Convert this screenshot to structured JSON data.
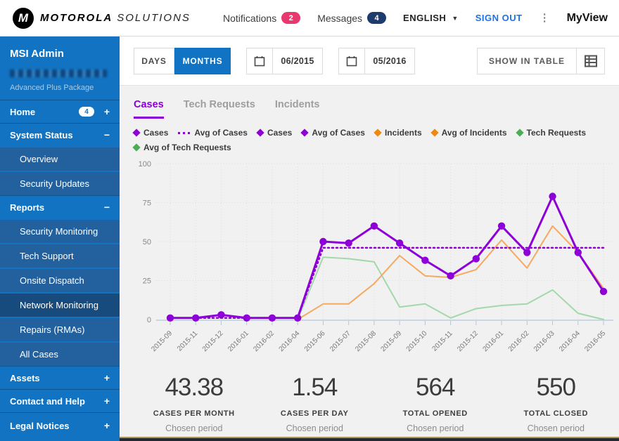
{
  "header": {
    "brand_primary": "MOTOROLA",
    "brand_secondary": "SOLUTIONS",
    "notifications_label": "Notifications",
    "notifications_count": "2",
    "messages_label": "Messages",
    "messages_count": "4",
    "language": "ENGLISH",
    "sign_out_label": "SIGN OUT",
    "product_name": "MyView",
    "colors": {
      "notifications_badge": "#e8386d",
      "messages_badge": "#1d3c6b",
      "sign_out": "#1a73e8"
    }
  },
  "sidebar": {
    "user_name": "MSI Admin",
    "package_label": "Advanced Plus Package",
    "items": [
      {
        "label": "Home",
        "type": "top",
        "badge": "4",
        "toggle": "+"
      },
      {
        "label": "System Status",
        "type": "top",
        "toggle": "−"
      },
      {
        "label": "Overview",
        "type": "sub"
      },
      {
        "label": "Security Updates",
        "type": "sub"
      },
      {
        "label": "Reports",
        "type": "top",
        "toggle": "−"
      },
      {
        "label": "Security Monitoring",
        "type": "sub"
      },
      {
        "label": "Tech Support",
        "type": "sub"
      },
      {
        "label": "Onsite Dispatch",
        "type": "sub"
      },
      {
        "label": "Network Monitoring",
        "type": "sub",
        "selected": true
      },
      {
        "label": "Repairs (RMAs)",
        "type": "sub"
      },
      {
        "label": "All Cases",
        "type": "sub"
      },
      {
        "label": "Assets",
        "type": "top",
        "toggle": "+"
      },
      {
        "label": "Contact and Help",
        "type": "top",
        "toggle": "+"
      },
      {
        "label": "Legal Notices",
        "type": "top",
        "toggle": "+",
        "tall": true
      }
    ],
    "colors": {
      "base": "#1173c2",
      "submenu": "#22609e",
      "selected": "#174a7d"
    }
  },
  "toolbar": {
    "days_label": "DAYS",
    "months_label": "MONTHS",
    "date_from": "06/2015",
    "date_to": "05/2016",
    "show_in_table_label": "SHOW IN TABLE"
  },
  "tabs": [
    {
      "label": "Cases",
      "active": true
    },
    {
      "label": "Tech Requests",
      "active": false
    },
    {
      "label": "Incidents",
      "active": false
    }
  ],
  "legend": [
    {
      "label": "Cases",
      "marker": "diamond",
      "color": "#8f00d4"
    },
    {
      "label": "Avg of Cases",
      "marker": "dotted",
      "color": "#8f00d4"
    },
    {
      "label": "Cases",
      "marker": "diamond",
      "color": "#8f00d4"
    },
    {
      "label": "Avg of Cases",
      "marker": "diamond",
      "color": "#8f00d4"
    },
    {
      "label": "Incidents",
      "marker": "diamond",
      "color": "#f0870e"
    },
    {
      "label": "Avg of Incidents",
      "marker": "diamond",
      "color": "#f0870e"
    },
    {
      "label": "Tech Requests",
      "marker": "diamond",
      "color": "#4cae52"
    },
    {
      "label": "Avg of Tech Requests",
      "marker": "diamond",
      "color": "#4cae52"
    }
  ],
  "chart_data": {
    "type": "line",
    "title": "",
    "xlabel": "",
    "ylabel": "",
    "ylim": [
      0,
      100
    ],
    "yticks": [
      0,
      25,
      50,
      75,
      100
    ],
    "grid": true,
    "legend_position": "top",
    "categories": [
      "2015-09",
      "2015-11",
      "2015-12",
      "2016-01",
      "2016-02",
      "2016-04",
      "2015-06",
      "2015-07",
      "2015-08",
      "2015-09",
      "2015-10",
      "2015-11",
      "2015-12",
      "2016-01",
      "2016-02",
      "2016-03",
      "2016-04",
      "2016-05"
    ],
    "series": [
      {
        "name": "Tech Requests",
        "color": "#a2d8aa",
        "width": 2,
        "marker": false,
        "values": [
          null,
          null,
          null,
          null,
          null,
          0,
          40,
          39,
          37,
          8,
          10,
          1,
          7,
          9,
          10,
          19,
          4,
          0
        ]
      },
      {
        "name": "Incidents",
        "color": "#f5a961",
        "width": 2,
        "marker": false,
        "values": [
          null,
          null,
          null,
          null,
          null,
          0,
          10,
          10,
          23,
          41,
          28,
          27,
          32,
          51,
          33,
          60,
          43,
          20
        ]
      },
      {
        "name": "Avg of Cases",
        "color": "#8f00d4",
        "width": 2.5,
        "dash": "2,4",
        "marker": false,
        "values": [
          1,
          1,
          1,
          1,
          1,
          1,
          46,
          46,
          46,
          46,
          46,
          46,
          46,
          46,
          46,
          46,
          46,
          46
        ]
      },
      {
        "name": "Cases",
        "color": "#8e00d8",
        "width": 3,
        "marker": true,
        "values": [
          1,
          1,
          3,
          1,
          1,
          1,
          50,
          49,
          60,
          49,
          38,
          28,
          39,
          60,
          43,
          79,
          43,
          18
        ]
      }
    ]
  },
  "stats": [
    {
      "value": "43.38",
      "label": "CASES PER MONTH",
      "sub": "Chosen period"
    },
    {
      "value": "1.54",
      "label": "CASES PER DAY",
      "sub": "Chosen period"
    },
    {
      "value": "564",
      "label": "TOTAL OPENED",
      "sub": "Chosen period"
    },
    {
      "value": "550",
      "label": "TOTAL CLOSED",
      "sub": "Chosen period"
    }
  ]
}
